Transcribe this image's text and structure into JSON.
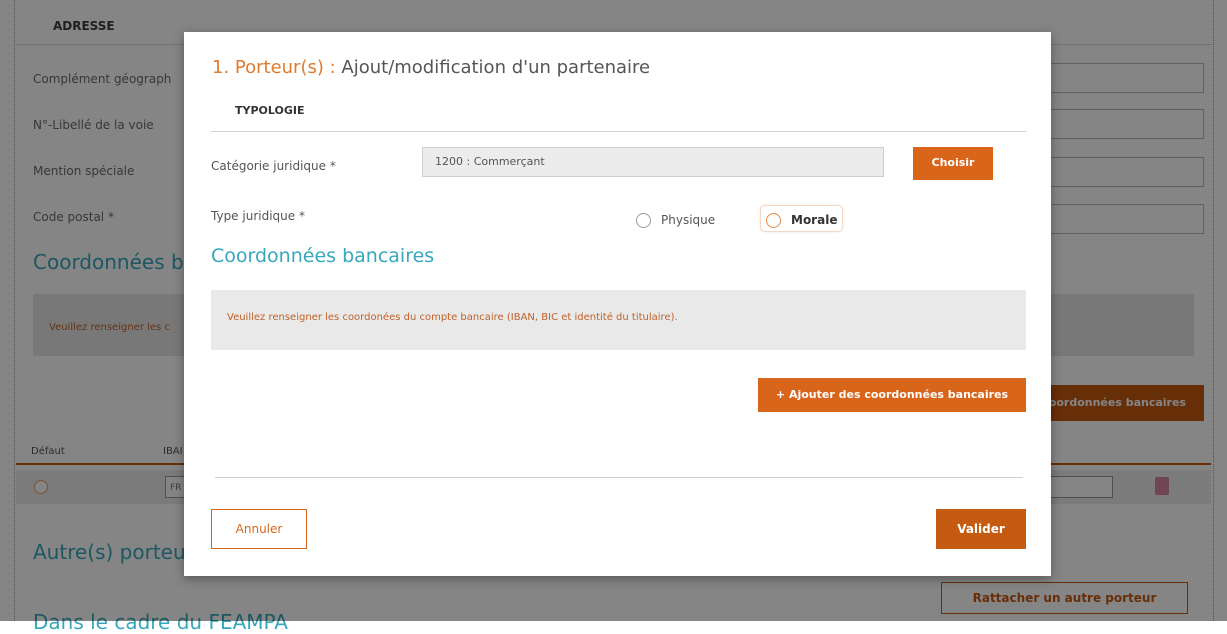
{
  "background": {
    "address_header": "ADRESSE",
    "labels": {
      "complement": "Complément géograph",
      "street": "N°-Libellé de la voie",
      "mention": "Mention spéciale",
      "postal_code": "Code postal *"
    },
    "bank_section_title": "Coordonnées b",
    "info_text": "Veuillez renseigner les c",
    "bank_button_label": "oordonnées bancaires",
    "table": {
      "col_default": "Défaut",
      "col_iban": "IBAI",
      "row_iban_value": "FR"
    },
    "other_holders_title": "Autre(s) porteu",
    "attach_button_label": "Rattacher un autre porteur",
    "bottom_title": "Dans le cadre du FEAMPA"
  },
  "modal": {
    "title_prefix": "1. Porteur(s) : ",
    "title_rest": "Ajout/modification d'un partenaire",
    "section_typology": "TYPOLOGIE",
    "category": {
      "label": "Catégorie juridique *",
      "value": "1200 : Commerçant",
      "choose_button": "Choisir"
    },
    "type": {
      "label": "Type juridique *",
      "options": [
        "Physique",
        "Morale"
      ],
      "selected": "Morale"
    },
    "bank": {
      "title": "Coordonnées bancaires",
      "info": "Veuillez renseigner les coordonées du compte bancaire (IBAN, BIC et identité du titulaire).",
      "add_button": "+ Ajouter des coordonnées bancaires"
    },
    "actions": {
      "cancel": "Annuler",
      "validate": "Valider"
    }
  },
  "colors": {
    "accent_orange": "#d9651a",
    "dark_orange": "#c55a11",
    "title_teal": "#37a7bd",
    "info_text": "#c0622a"
  }
}
